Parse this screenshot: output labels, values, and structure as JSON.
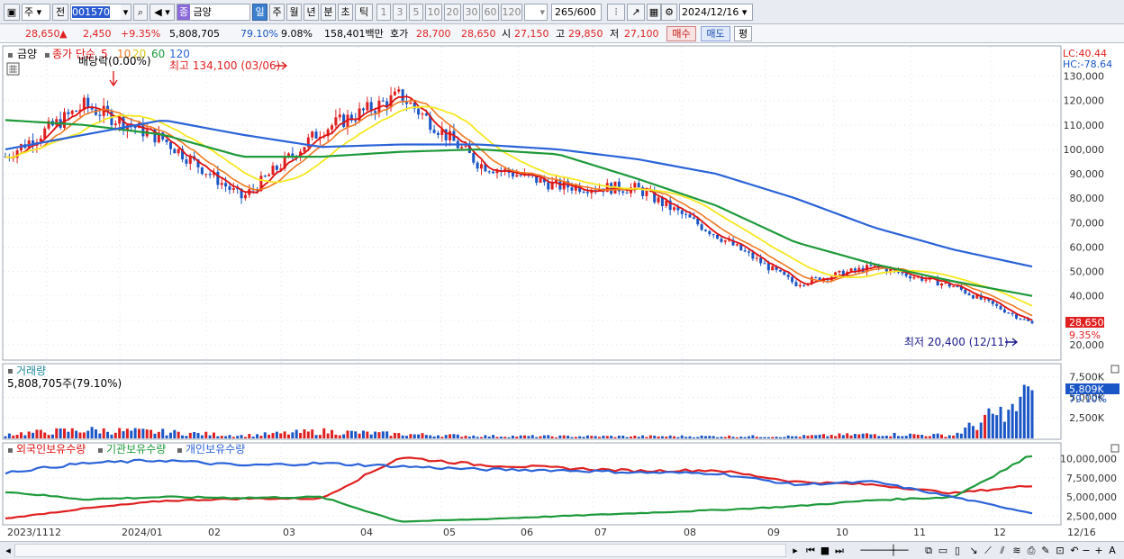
{
  "toolbar": {
    "market": "주",
    "prev_label": "전",
    "code": "001570",
    "name_badge": "종",
    "name": "금양",
    "periods": [
      "일",
      "주",
      "월",
      "년",
      "분",
      "초",
      "틱"
    ],
    "intervals": [
      "1",
      "3",
      "5",
      "10",
      "20",
      "30",
      "60",
      "120"
    ],
    "bars_count": "265",
    "bars_total": "/600",
    "date": "2024/12/16"
  },
  "info": {
    "price": "28,650",
    "arrow": "▲",
    "change": "2,450",
    "change_pct": "+9.35%",
    "volume": "5,808,705",
    "vol_ratio": "79.10%",
    "turnover": "9.08%",
    "amount": "158,401백만",
    "bid_label": "호가",
    "bid": "28,700",
    "ask": "28,650",
    "open_label": "시",
    "open": "27,150",
    "high_label": "고",
    "high": "29,850",
    "low_label": "저",
    "low": "27,100",
    "buy": "매수",
    "sell": "매도",
    "eval": "평"
  },
  "chart": {
    "price_legend": {
      "name": "금양",
      "ma_label": "종가 단순",
      "ma_periods": [
        "5",
        "10",
        "20",
        "60",
        "120"
      ]
    },
    "dividend_label": "배당락(0.00%)",
    "max_label": "최고 134,100 (03/06)",
    "min_label": "최저 20,400 (12/11)",
    "lc": "LC:40.44",
    "hc": "HC:-78.64",
    "price_axis": [
      "130,000",
      "120,000",
      "110,000",
      "100,000",
      "90,000",
      "80,000",
      "70,000",
      "60,000",
      "50,000",
      "40,000",
      "30,000",
      "20,000"
    ],
    "price_tag": "28,650",
    "pct_tag": "9.35%",
    "volume_title": "거래량",
    "volume_value": "5,808,705주(79.10%)",
    "vol_axis": [
      "7,500K",
      "5,000K",
      "2,500K"
    ],
    "vol_tag": "5,809K",
    "vol_pct": "79.10%",
    "holdings_legend": [
      "외국인보유수량",
      "기관보유수량",
      "개인보유수량"
    ],
    "hold_axis": [
      "10,000,000",
      "7,500,000",
      "5,000,000",
      "2,500,000"
    ],
    "x_axis": [
      "2023/11",
      "12",
      "2024/01",
      "02",
      "03",
      "04",
      "05",
      "06",
      "07",
      "08",
      "09",
      "10",
      "11",
      "12",
      "12/16"
    ],
    "colors": {
      "up": "#e02020",
      "down": "#1a56c6",
      "ma5": "#e01010",
      "ma10": "#f07820",
      "ma20": "#f6e820",
      "ma60": "#1d9a3a",
      "ma120": "#2a63d8"
    }
  },
  "chart_data": [
    {
      "type": "candlestick",
      "title": "금양",
      "x": [
        "2023/11",
        "12",
        "2024/01",
        "02",
        "03",
        "04",
        "05",
        "06",
        "07",
        "08",
        "09",
        "10",
        "11",
        "12"
      ],
      "series": [
        {
          "name": "close",
          "values": [
            97000,
            118000,
            104000,
            80000,
            108000,
            122000,
            94000,
            85000,
            84000,
            65000,
            45000,
            52000,
            44000,
            28650
          ]
        },
        {
          "name": "60",
          "values": [
            112000,
            110000,
            106000,
            97000,
            97000,
            99000,
            100000,
            98000,
            88000,
            77000,
            62000,
            53000,
            46000,
            40000
          ]
        },
        {
          "name": "120",
          "values": [
            100000,
            106000,
            112000,
            106000,
            101000,
            102000,
            102000,
            100000,
            96000,
            90000,
            80000,
            68000,
            59000,
            52000
          ]
        }
      ],
      "ylim": [
        20000,
        135000
      ],
      "high": 134100,
      "low": 20400
    },
    {
      "type": "bar",
      "title": "거래량",
      "categories": [
        "2023/11",
        "12",
        "2024/01",
        "02",
        "03",
        "04",
        "05",
        "06",
        "07",
        "08",
        "09",
        "10",
        "11",
        "12"
      ],
      "values": [
        600,
        1200,
        900,
        400,
        1000,
        600,
        350,
        300,
        300,
        300,
        300,
        600,
        450,
        5809
      ]
    },
    {
      "type": "line",
      "title": "",
      "x": [
        "2023/11",
        "12",
        "2024/01",
        "02",
        "03",
        "04",
        "05",
        "06",
        "07",
        "08",
        "09",
        "10",
        "11",
        "12"
      ],
      "series": [
        {
          "name": "외국인보유수량",
          "values": [
            2200000,
            3500000,
            4500000,
            4800000,
            4800000,
            10200000,
            9200000,
            8800000,
            8400000,
            8500000,
            7000000,
            6600000,
            5500000,
            6500000
          ]
        },
        {
          "name": "기관보유수량",
          "values": [
            5700000,
            4700000,
            5000000,
            4900000,
            5000000,
            1800000,
            2100000,
            2500000,
            2900000,
            3300000,
            3800000,
            4600000,
            5000000,
            10500000
          ]
        },
        {
          "name": "개인보유수량",
          "values": [
            8200000,
            9400000,
            9800000,
            9100000,
            9400000,
            9000000,
            8600000,
            8500000,
            8200000,
            8100000,
            6600000,
            7000000,
            5000000,
            2900000
          ]
        }
      ],
      "ylim": [
        1500000,
        11000000
      ]
    }
  ]
}
